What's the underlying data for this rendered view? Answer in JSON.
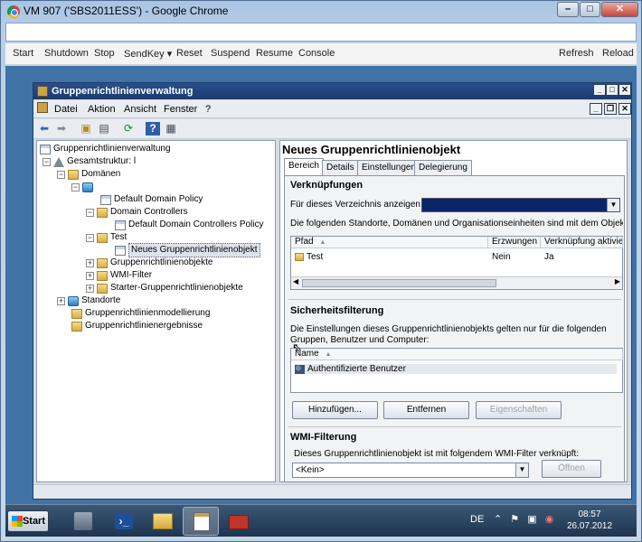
{
  "browser": {
    "title": "VM 907 ('SBS2011ESS') - Google Chrome",
    "min_glyph": "–",
    "max_glyph": "□",
    "close_glyph": "✕"
  },
  "vm_toolbar": {
    "items": [
      "Start",
      "Shutdown",
      "Stop",
      "SendKey ▾",
      "Reset",
      "Suspend",
      "Resume",
      "Console"
    ],
    "refresh": "Refresh",
    "reload": "Reload"
  },
  "mmc": {
    "title": "Gruppenrichtlinienverwaltung",
    "menu": [
      "Datei",
      "Aktion",
      "Ansicht",
      "Fenster",
      "?"
    ],
    "window_glyphs": {
      "min": "_",
      "max": "□",
      "close": "✕"
    },
    "inner_glyphs": {
      "min": "_",
      "restore": "❐",
      "close": "✕"
    },
    "toolbar_icons": [
      "back-arrow-icon",
      "forward-arrow-icon",
      "up-folder-icon",
      "show-hide-tree-icon",
      "refresh-icon",
      "help-icon",
      "properties-icon"
    ]
  },
  "tree": {
    "root": "Gruppenrichtlinienverwaltung",
    "forest": "Gesamtstruktur: l",
    "domains": "Domänen",
    "default_domain_policy": "Default Domain Policy",
    "domain_controllers": "Domain Controllers",
    "default_dc_policy": "Default Domain Controllers Policy",
    "test": "Test",
    "new_gpo": "Neues Gruppenrichtlinienobjekt",
    "gpos": "Gruppenrichtlinienobjekte",
    "wmi_filter": "WMI-Filter",
    "starter_gpos": "Starter-Gruppenrichtlinienobjekte",
    "sites": "Standorte",
    "modeling": "Gruppenrichtlinienmodellierung",
    "results": "Gruppenrichtlinienergebnisse",
    "expand": "+",
    "collapse": "−"
  },
  "details": {
    "title": "Neues Gruppenrichtlinienobjekt",
    "tabs": [
      "Bereich",
      "Details",
      "Einstellungen",
      "Delegierung"
    ],
    "links_title": "Verknüpfungen",
    "links_show_label": "Für dieses Verzeichnis anzeigen:",
    "links_desc": "Die folgenden Standorte, Domänen und Organisationseinheiten sind mit dem Objekt verknü",
    "links_columns": [
      "Pfad",
      "Erzwungen",
      "Verknüpfung aktiviert"
    ],
    "links_rows": [
      {
        "path": "Test",
        "enforced": "Nein",
        "enabled": "Ja"
      }
    ],
    "security_title": "Sicherheitsfilterung",
    "security_desc_1": "Die Einstellungen dieses Gruppenrichtlinienobjekts gelten nur für die folgenden",
    "security_desc_2": "Gruppen, Benutzer und Computer:",
    "security_columns": [
      "Name"
    ],
    "security_rows": [
      "Authentifizierte Benutzer"
    ],
    "btn_add": "Hinzufügen...",
    "btn_remove": "Entfernen",
    "btn_properties": "Eigenschaften",
    "wmi_title": "WMI-Filterung",
    "wmi_desc": "Dieses Gruppenrichtlinienobjekt ist mit folgendem WMI-Filter verknüpft:",
    "wmi_value": "<Kein>",
    "btn_open": "Öffnen",
    "sort_glyph": "▲",
    "dropdown_glyph": "▼",
    "scroll_left": "◀",
    "scroll_right": "▶"
  },
  "taskbar": {
    "start": "Start",
    "language": "DE",
    "time": "08:57",
    "date": "26.07.2012",
    "icons": [
      "server-manager-icon",
      "powershell-icon",
      "explorer-icon",
      "gpo-management-icon",
      "toolbox-icon"
    ]
  }
}
